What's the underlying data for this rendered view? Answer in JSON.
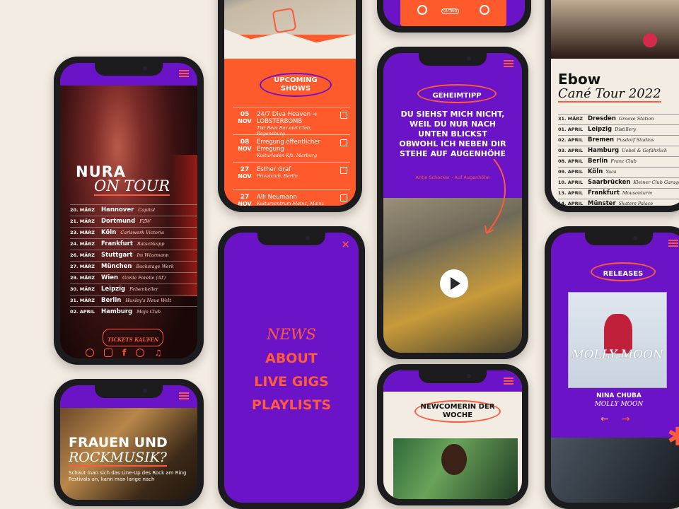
{
  "nura": {
    "title": "NURA",
    "subtitle": "ON TOUR",
    "dates": [
      {
        "date": "20. MÄRZ",
        "city": "Hannover",
        "venue": "Capitol"
      },
      {
        "date": "21. MÄRZ",
        "city": "Dortmund",
        "venue": "FZW"
      },
      {
        "date": "23. MÄRZ",
        "city": "Köln",
        "venue": "Carlswerk Victoria"
      },
      {
        "date": "24. MÄRZ",
        "city": "Frankfurt",
        "venue": "Batschkapp"
      },
      {
        "date": "26. MÄRZ",
        "city": "Stuttgart",
        "venue": "Im Wizemann"
      },
      {
        "date": "27. MÄRZ",
        "city": "München",
        "venue": "Backstage Werk"
      },
      {
        "date": "29. MÄRZ",
        "city": "Wien",
        "venue": "Grelle Forelle (AT)"
      },
      {
        "date": "30. MÄRZ",
        "city": "Leipzig",
        "venue": "Felsenkeller"
      },
      {
        "date": "31. MÄRZ",
        "city": "Berlin",
        "venue": "Huxley's Neue Welt"
      },
      {
        "date": "02. APRIL",
        "city": "Hamburg",
        "venue": "Mojo Club"
      }
    ],
    "tickets_label": "TICKETS KAUFEN",
    "social_icons": [
      "globe-icon",
      "instagram-icon",
      "facebook-icon",
      "spotify-icon",
      "music-icon"
    ]
  },
  "upcoming": {
    "heading": "UPCOMING SHOWS",
    "shows": [
      {
        "day": "05",
        "month": "NOV",
        "name": "24/7 Diva Heaven + LOBSTERBOMB",
        "venue": "Tiki Beat Bar and Club, Regensburg"
      },
      {
        "day": "08",
        "month": "NOV",
        "name": "Erregung öffentlicher Erregung",
        "venue": "Kulturladen Kfz, Marburg"
      },
      {
        "day": "27",
        "month": "NOV",
        "name": "Esther Graf",
        "venue": "Privatclub, Berlin"
      },
      {
        "day": "27",
        "month": "NOV",
        "name": "Alli Neumann",
        "venue": "Kulturzentrum Mainz, Mainz"
      }
    ]
  },
  "cassette": {
    "brand": "OUTBID"
  },
  "geheimtipp": {
    "heading": "GEHEIMTIPP",
    "quote": "DU SIEHST MICH NICHT, WEIL DU NUR NACH UNTEN BLICKST OBWOHL ICH NEBEN DIR STEHE AUF AUGENHÖHE",
    "source": "Antje Schocker - Auf Augenhöhe"
  },
  "ebow": {
    "artist": "Ebow",
    "tour": "Cané Tour 2022",
    "dates": [
      {
        "date": "31. MÄRZ",
        "city": "Dresden",
        "venue": "Groove Station"
      },
      {
        "date": "01. APRIL",
        "city": "Leipzig",
        "venue": "Distillery"
      },
      {
        "date": "02. APRIL",
        "city": "Bremen",
        "venue": "Pusdorf Studios"
      },
      {
        "date": "03. APRIL",
        "city": "Hamburg",
        "venue": "Uebel & Gefährlich"
      },
      {
        "date": "08. APRIL",
        "city": "Berlin",
        "venue": "Franz Club"
      },
      {
        "date": "09. APRIL",
        "city": "Köln",
        "venue": "Yuca"
      },
      {
        "date": "10. APRIL",
        "city": "Saarbrücken",
        "venue": "Kleiner Club Garage"
      },
      {
        "date": "13. APRIL",
        "city": "Frankfurt",
        "venue": "Mousonturm"
      },
      {
        "date": "14. APRIL",
        "city": "Münster",
        "venue": "Skaters Palace"
      }
    ]
  },
  "menu": {
    "items": [
      "NEWS",
      "ABOUT",
      "LIVE GIGS",
      "PLAYLISTS"
    ]
  },
  "releases": {
    "heading": "RELEASES",
    "album_cover_text": "MOLLY MOON",
    "artist": "NINA CHUBA",
    "album": "MOLLY MOON"
  },
  "newcomerin": {
    "heading": "NEWCOMERIN DER WOCHE"
  },
  "frauen": {
    "heading_line1": "FRAUEN UND",
    "heading_line2": "ROCKMUSIK?",
    "teaser": "Schaut man sich das Line-Up des Rock am Ring Festivals an, kann man lange nach"
  },
  "colors": {
    "purple": "#6b13c6",
    "orange": "#ff5a2c",
    "cream": "#f3ece2",
    "accent": "#ff5a3c"
  }
}
